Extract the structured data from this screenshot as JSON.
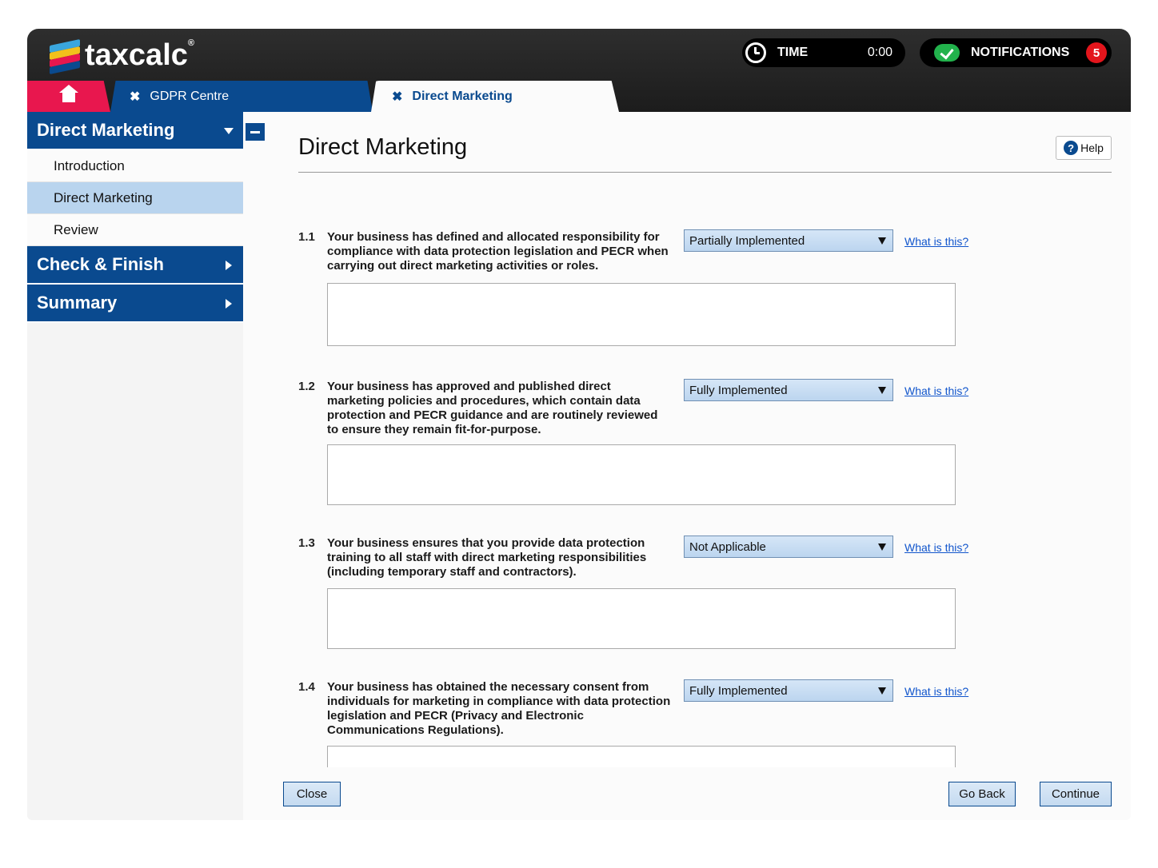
{
  "header": {
    "logo_text": "taxcalc",
    "logo_mark": "®",
    "time_label": "TIME",
    "time_value": "0:00",
    "notifications_label": "NOTIFICATIONS",
    "notifications_count": "5"
  },
  "tabs": [
    {
      "label": "",
      "icon": "home-icon",
      "color": "#e8174e"
    },
    {
      "label": "GDPR Centre",
      "close": "✖"
    },
    {
      "label": "Direct Marketing",
      "close": "✖",
      "active": true
    }
  ],
  "sidebar": {
    "section1": {
      "label": "Direct Marketing",
      "items": [
        "Introduction",
        "Direct Marketing",
        "Review"
      ],
      "active_index": 1
    },
    "section2": {
      "label": "Check & Finish"
    },
    "section3": {
      "label": "Summary"
    }
  },
  "main": {
    "title": "Direct Marketing",
    "help_label": "Help",
    "help_icon": "?",
    "questions": [
      {
        "num": "1.1",
        "text": "Your business has defined and allocated responsibility for compliance with data protection legislation and PECR when carrying out direct marketing activities or roles.",
        "status": "Partially Implemented",
        "link": "What is this?",
        "notes": ""
      },
      {
        "num": "1.2",
        "text": "Your business has approved and published direct marketing policies and procedures, which contain data protection and PECR guidance and are routinely reviewed to ensure they remain fit-for-purpose.",
        "status": "Fully Implemented",
        "link": "What is this?",
        "notes": ""
      },
      {
        "num": "1.3",
        "text": "Your business ensures that you provide data protection training to all staff with direct marketing responsibilities (including temporary staff and contractors).",
        "status": "Not Applicable",
        "link": "What is this?",
        "notes": ""
      },
      {
        "num": "1.4",
        "text": "Your business has obtained the necessary consent from individuals for marketing in compliance with data protection legislation and PECR (Privacy and Electronic Communications Regulations).",
        "status": "Fully Implemented",
        "link": "What is this?",
        "notes": ""
      }
    ],
    "buttons": {
      "close": "Close",
      "back": "Go Back",
      "continue": "Continue"
    }
  },
  "colors": {
    "brand_blue": "#0a4a8f",
    "home_tab": "#e8174e",
    "active_nav": "#b9d4ee",
    "badge": "#e3151c",
    "check": "#22b24c"
  }
}
